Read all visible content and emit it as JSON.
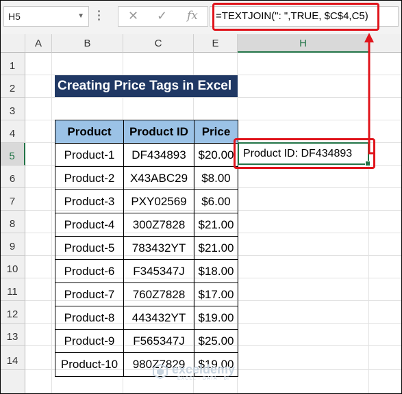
{
  "formula_bar": {
    "name_box": "H5",
    "formula": "=TEXTJOIN(\": \",TRUE, $C$4,C5)",
    "icons": [
      "cancel-icon",
      "enter-icon",
      "function-icon"
    ]
  },
  "columns": [
    "A",
    "B",
    "C",
    "E",
    "H"
  ],
  "rows": [
    "1",
    "2",
    "3",
    "4",
    "5",
    "6",
    "7",
    "8",
    "9",
    "10",
    "11",
    "12",
    "13",
    "14"
  ],
  "selected": {
    "row": "5",
    "column": "H"
  },
  "title": "Creating Price Tags in Excel",
  "table": {
    "headers": [
      "Product",
      "Product ID",
      "Price"
    ],
    "rows": [
      [
        "Product-1",
        "DF434893",
        "$20.00"
      ],
      [
        "Product-2",
        "X43ABC29",
        "$8.00"
      ],
      [
        "Product-3",
        "PXY02569",
        "$6.00"
      ],
      [
        "Product-4",
        "300Z7828",
        "$21.00"
      ],
      [
        "Product-5",
        "783432YT",
        "$21.00"
      ],
      [
        "Product-6",
        "F345347J",
        "$18.00"
      ],
      [
        "Product-7",
        "760Z7828",
        "$17.00"
      ],
      [
        "Product-8",
        "443432YT",
        "$19.00"
      ],
      [
        "Product-9",
        "F565347J",
        "$25.00"
      ],
      [
        "Product-10",
        "980Z7829",
        "$19.00"
      ]
    ]
  },
  "result_cell": "Product ID: DF434893",
  "watermark": {
    "brand": "exceldemy",
    "tagline": "EXCEL · DATA · BI"
  },
  "colors": {
    "highlight": "#e0141b",
    "title_bg": "#203864",
    "header_bg": "#9bc2e6",
    "selection": "#217346"
  }
}
